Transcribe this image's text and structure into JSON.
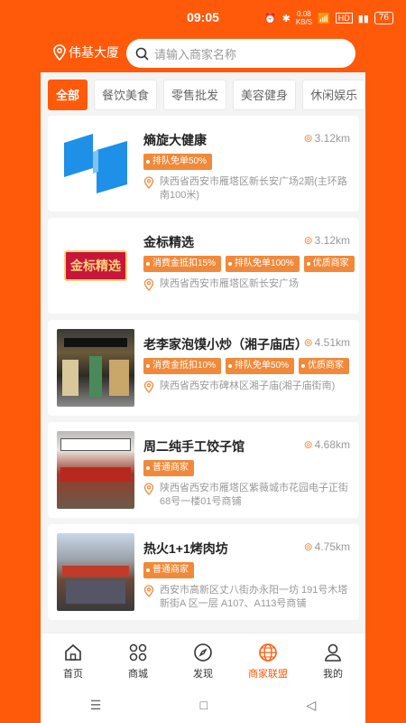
{
  "status": {
    "time": "09:05",
    "speed_value": "0.08",
    "speed_unit": "KB/S",
    "hd": "HD",
    "battery": "76"
  },
  "top": {
    "location": "伟基大厦",
    "search_placeholder": "请输入商家名称"
  },
  "categories": [
    "全部",
    "餐饮美食",
    "零售批发",
    "美容健身",
    "休闲娱乐"
  ],
  "shops": [
    {
      "name": "熵旋大健康",
      "distance": "3.12km",
      "tags": [
        "排队免单50%"
      ],
      "address": "陕西省西安市雁塔区新长安广场2期(主环路南100米)"
    },
    {
      "name": "金标精选",
      "distance": "3.12km",
      "tags": [
        "消费金抵扣15%",
        "排队免单100%",
        "优质商家"
      ],
      "address": "陕西省西安市雁塔区新长安广场",
      "logo_text": "金标精选"
    },
    {
      "name": "老李家泡馍小炒（湘子庙店）",
      "distance": "4.51km",
      "tags": [
        "消费金抵扣10%",
        "排队免单50%",
        "优质商家"
      ],
      "address": "陕西省西安市碑林区湘子庙(湘子庙街南)"
    },
    {
      "name": "周二纯手工饺子馆",
      "distance": "4.68km",
      "tags": [
        "普通商家"
      ],
      "address": "陕西省西安市雁塔区紫薇城市花园电子正街68号一楼01号商铺"
    },
    {
      "name": "热火1+1烤肉坊",
      "distance": "4.75km",
      "tags": [
        "普通商家"
      ],
      "address": "西安市高新区丈八街办永阳一坊 191号木塔新街A 区一层 A107、A113号商铺"
    }
  ],
  "tabs": [
    "首页",
    "商城",
    "发现",
    "商家联盟",
    "我的"
  ],
  "colors": {
    "accent": "#ff5a0a",
    "tag": "#f08a3a"
  }
}
